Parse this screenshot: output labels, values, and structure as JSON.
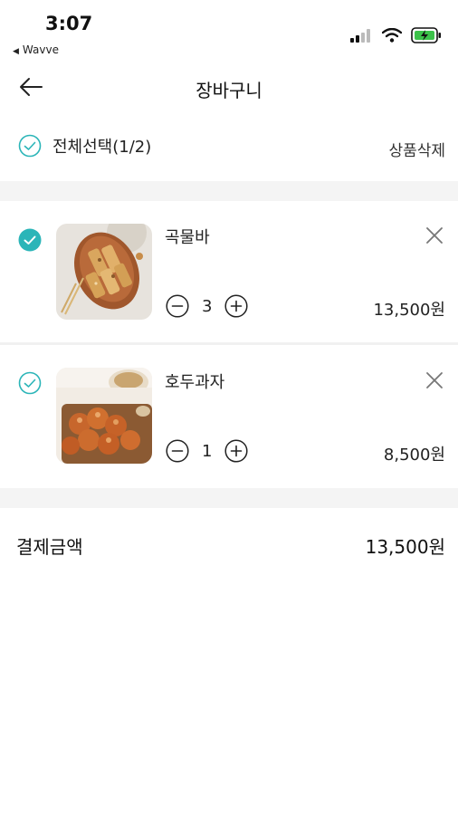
{
  "status_bar": {
    "time": "3:07",
    "back_app": "Wavve"
  },
  "header": {
    "title": "장바구니"
  },
  "select_all": {
    "label": "전체선택(1/2)",
    "delete_label": "상품삭제"
  },
  "items": [
    {
      "name": "곡물바",
      "quantity": "3",
      "price": "13,500원",
      "checked": true
    },
    {
      "name": "호두과자",
      "quantity": "1",
      "price": "8,500원",
      "checked": false
    }
  ],
  "payment": {
    "label": "결제금액",
    "amount": "13,500원"
  },
  "colors": {
    "accent": "#2bb5b8",
    "band": "#f4f4f4"
  }
}
